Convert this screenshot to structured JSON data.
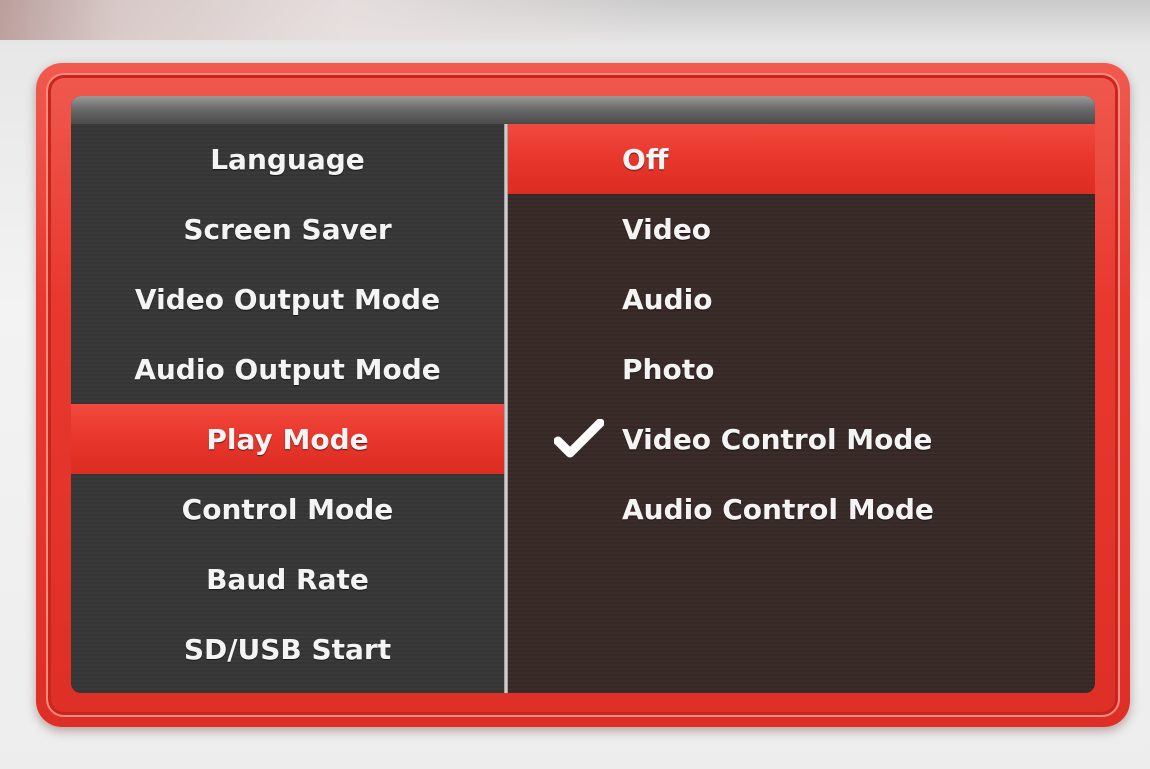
{
  "left_menu": {
    "items": [
      {
        "label": "Language",
        "selected": false
      },
      {
        "label": "Screen Saver",
        "selected": false
      },
      {
        "label": "Video Output Mode",
        "selected": false
      },
      {
        "label": "Audio Output Mode",
        "selected": false
      },
      {
        "label": "Play Mode",
        "selected": true
      },
      {
        "label": "Control Mode",
        "selected": false
      },
      {
        "label": "Baud Rate",
        "selected": false
      },
      {
        "label": "SD/USB Start",
        "selected": false
      }
    ]
  },
  "right_menu": {
    "items": [
      {
        "label": "Off",
        "selected": true,
        "checked": false
      },
      {
        "label": "Video",
        "selected": false,
        "checked": false
      },
      {
        "label": "Audio",
        "selected": false,
        "checked": false
      },
      {
        "label": "Photo",
        "selected": false,
        "checked": false
      },
      {
        "label": "Video Control Mode",
        "selected": false,
        "checked": true
      },
      {
        "label": "Audio Control Mode",
        "selected": false,
        "checked": false
      }
    ]
  },
  "icons": {
    "checked_marker": "check-icon"
  },
  "colors": {
    "accent_red": "#e8362b",
    "frame_red": "#e8392f",
    "text": "#f4f4f4"
  }
}
